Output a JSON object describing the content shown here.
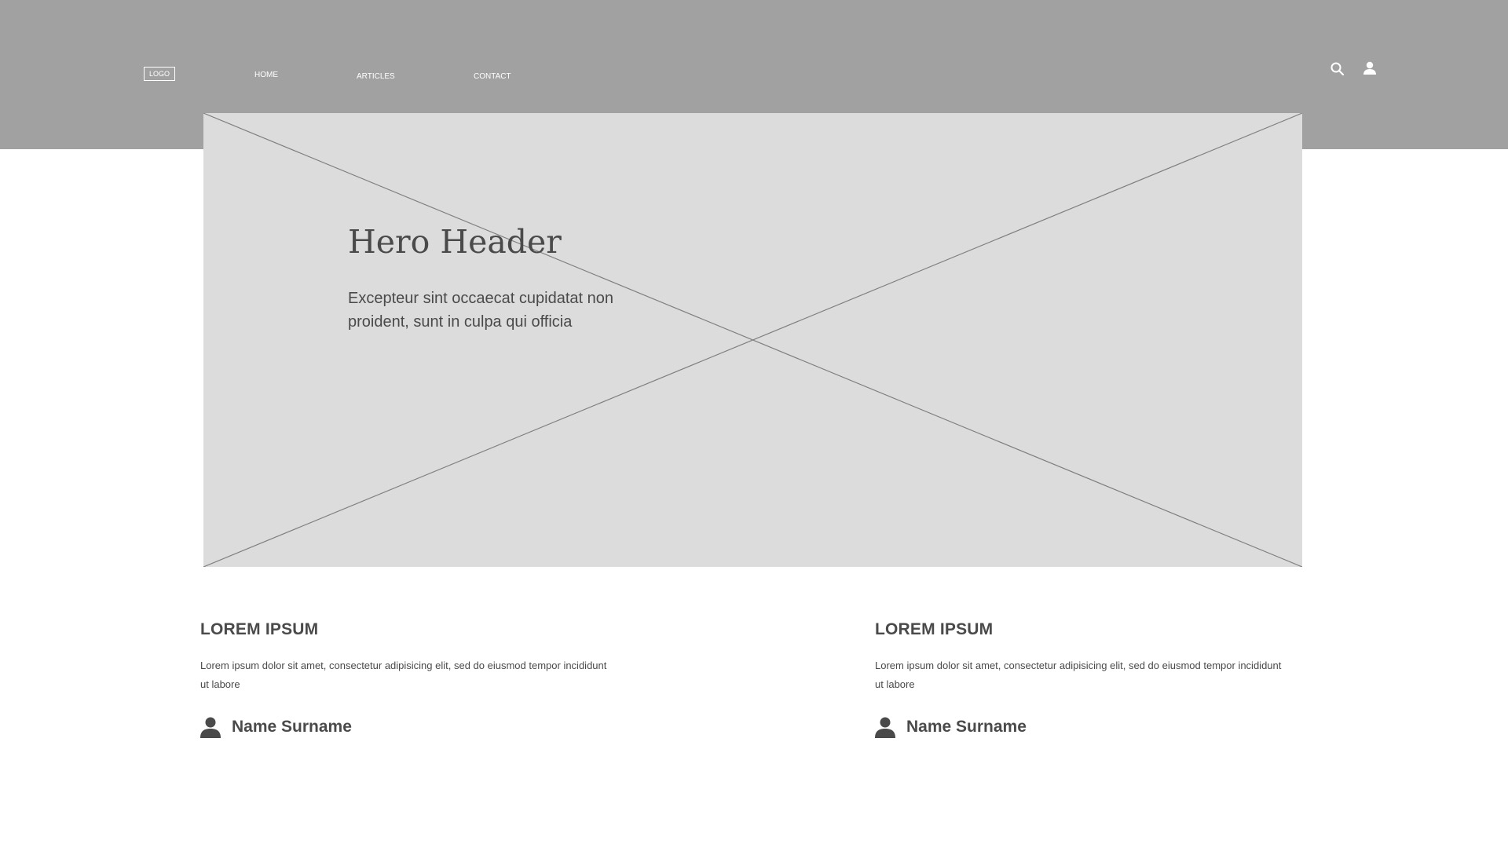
{
  "header": {
    "logo": "LOGO",
    "nav": [
      "HOME",
      "ARTICLES",
      "CONTACT"
    ],
    "icons": [
      "search-icon",
      "user-icon"
    ]
  },
  "hero": {
    "title": "Hero Header",
    "body": "Excepteur sint occaecat cupidatat non proident, sunt in culpa qui officia"
  },
  "cards": [
    {
      "title": "LOREM IPSUM",
      "text": "Lorem ipsum dolor sit amet, consectetur adipisicing elit, sed do eiusmod tempor incididunt ut labore",
      "author": "Name Surname"
    },
    {
      "title": "LOREM IPSUM",
      "text": "Lorem ipsum dolor sit amet, consectetur adipisicing elit, sed do eiusmod tempor incididunt ut labore",
      "author": "Name Surname"
    }
  ],
  "colors": {
    "header_bg": "#a1a1a1",
    "hero_bg": "#dcdcdc",
    "text": "#4a4a4a",
    "header_text": "#ffffff"
  }
}
